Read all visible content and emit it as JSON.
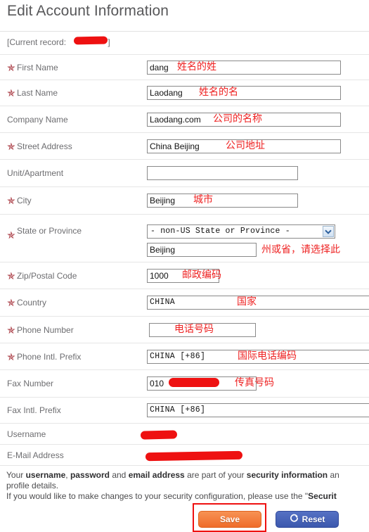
{
  "header": {
    "title": "Edit Account Information",
    "current_record_prefix": "[Current record:",
    "current_record_suffix": "]"
  },
  "form": {
    "rows": [
      {
        "label": "First Name",
        "required": true,
        "value": "dang",
        "annotation": "姓名的姓"
      },
      {
        "label": "Last Name",
        "required": true,
        "value": "Laodang",
        "annotation": "姓名的名"
      },
      {
        "label": "Company Name",
        "required": false,
        "value": "Laodang.com",
        "annotation": "公司的名称"
      },
      {
        "label": "Street Address",
        "required": true,
        "value": "China Beijing",
        "annotation": "公司地址"
      },
      {
        "label": "Unit/Apartment",
        "required": false,
        "value": "",
        "annotation": ""
      },
      {
        "label": "City",
        "required": true,
        "value": "Beijing",
        "annotation": "城市"
      },
      {
        "label": "State or Province",
        "required": true,
        "value": "Beijing",
        "annotation": "州或省，请选择此"
      },
      {
        "label": "Zip/Postal Code",
        "required": true,
        "value": "1000",
        "annotation": "邮政编码"
      },
      {
        "label": "Country",
        "required": true,
        "value": "CHINA",
        "annotation": "国家"
      },
      {
        "label": "Phone Number",
        "required": true,
        "value": "",
        "annotation": "电话号码"
      },
      {
        "label": "Phone Intl. Prefix",
        "required": true,
        "value": "CHINA  [+86]",
        "annotation": "国际电话编码"
      },
      {
        "label": "Fax Number",
        "required": false,
        "value": "010",
        "annotation": "传真号码"
      },
      {
        "label": "Fax Intl. Prefix",
        "required": false,
        "value": "CHINA  [+86]",
        "annotation": ""
      },
      {
        "label": "Username",
        "required": false,
        "value": "",
        "annotation": ""
      },
      {
        "label": "E-Mail Address",
        "required": false,
        "value": "",
        "annotation": ""
      }
    ],
    "state_select": {
      "selected_option": "- non-US State or Province -",
      "arrow_icon": "chevron-down-icon"
    }
  },
  "footer": {
    "line1_a": "Your ",
    "line1_b": "username",
    "line1_c": ", ",
    "line1_d": "password",
    "line1_e": " and ",
    "line1_f": "email address",
    "line1_g": " are part of your ",
    "line1_h": "security information",
    "line1_i": " an",
    "line2": "profile details.",
    "line3_a": "If you would like to make changes to your security configuration, please use the \"",
    "line3_b": "Securit"
  },
  "buttons": {
    "save_label": "Save",
    "reset_label": "Reset",
    "reset_icon": "refresh-icon"
  },
  "colors": {
    "accent_orange": "#ef6c2a",
    "accent_blue": "#3c58ae",
    "annotation_red": "#ee2222",
    "required_star": "#9d1f28",
    "label_gray": "#6d6d70",
    "redaction": "#ee1111"
  }
}
